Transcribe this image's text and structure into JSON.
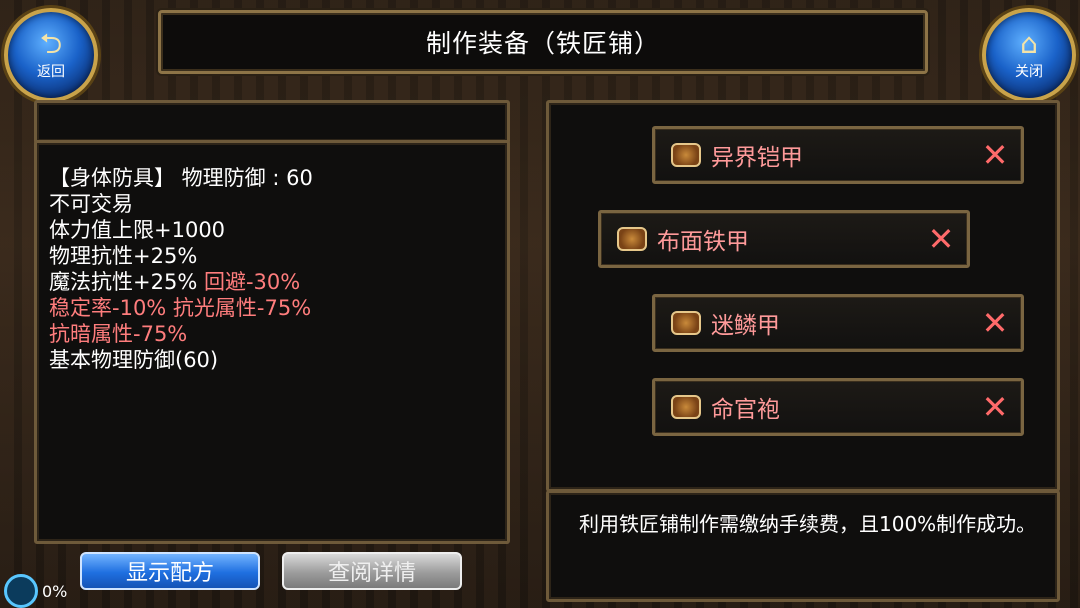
{
  "title": "制作装备（铁匠铺）",
  "nav": {
    "back_label": "返回",
    "close_label": "关闭",
    "back_icon": "back-arrow-icon",
    "close_icon": "home-icon"
  },
  "item_info": {
    "lines": [
      {
        "text": "【身体防具】 物理防御 :  60",
        "color": "#ffffff"
      },
      {
        "text": "不可交易",
        "color": "#ffffff"
      },
      {
        "text": "体力值上限+1000",
        "color": "#ffffff"
      },
      {
        "text": "物理抗性+25%",
        "color": "#ffffff"
      }
    ],
    "line5_white": "魔法抗性+25%",
    "line5_red": " 回避-30%",
    "line6": "稳定率-10% 抗光属性-75%",
    "line7": "抗暗属性-75%",
    "line8": "基本物理防御(60)"
  },
  "recipes": [
    {
      "name": "异界铠甲"
    },
    {
      "name": "布面铁甲"
    },
    {
      "name": "迷鳞甲"
    },
    {
      "name": "命官袍"
    }
  ],
  "note": "利用铁匠铺制作需缴纳手续费，且100%制作成功。",
  "buttons": {
    "show_recipe": "显示配方",
    "view_details": "查阅详情"
  },
  "status": {
    "percent": "0%"
  },
  "colors": {
    "accent_gold": "#8d7447",
    "debuff_red": "#ff7d7d",
    "button_blue": "#1f6fe0"
  }
}
